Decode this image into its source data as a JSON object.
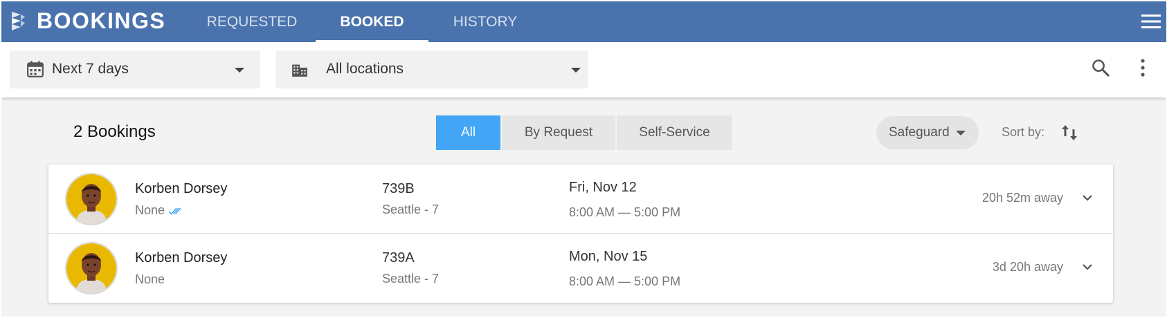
{
  "header": {
    "title": "BOOKINGS",
    "tabs": [
      {
        "label": "REQUESTED"
      },
      {
        "label": "BOOKED"
      },
      {
        "label": "HISTORY"
      }
    ],
    "active_tab": "BOOKED"
  },
  "toolbar": {
    "date_range": "Next 7 days",
    "location": "All locations"
  },
  "content": {
    "count_title": "2 Bookings",
    "segments": [
      {
        "label": "All"
      },
      {
        "label": "By Request"
      },
      {
        "label": "Self-Service"
      }
    ],
    "filter_pill": "Safeguard",
    "sort_label": "Sort by:"
  },
  "bookings": [
    {
      "name": "Korben Dorsey",
      "status": "None",
      "code": "739B",
      "location": "Seattle - 7",
      "date": "Fri, Nov 12",
      "time": "8:00 AM — 5:00 PM",
      "away": "20h 52m away"
    },
    {
      "name": "Korben Dorsey",
      "status": "None",
      "code": "739A",
      "location": "Seattle - 7",
      "date": "Mon, Nov 15",
      "time": "8:00 AM — 5:00 PM",
      "away": "3d 20h away"
    }
  ],
  "colors": {
    "header": "#4a73ae",
    "segment_active": "#42a5f5",
    "avatar_bg": "#e8b900",
    "check": "#42a5f5"
  }
}
